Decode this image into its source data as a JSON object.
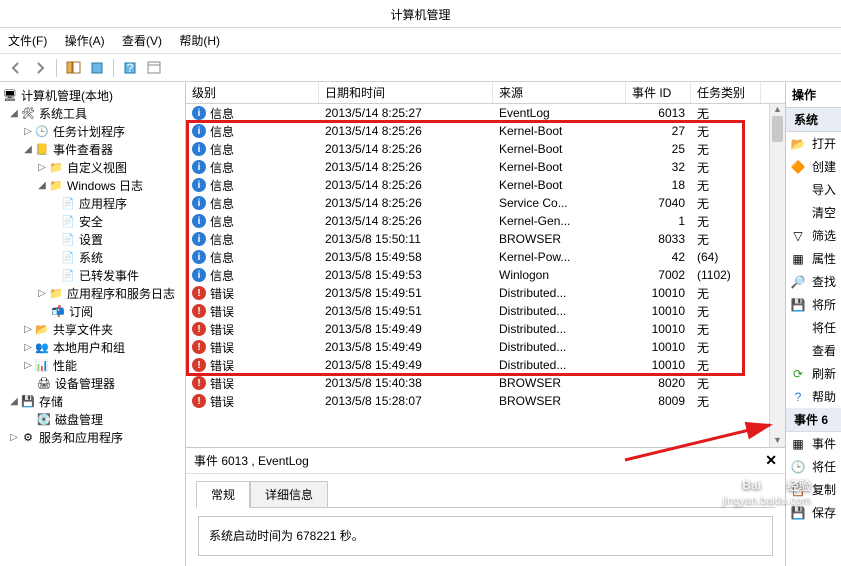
{
  "window": {
    "title": "计算机管理"
  },
  "menu": {
    "file": "文件(F)",
    "action": "操作(A)",
    "view": "查看(V)",
    "help": "帮助(H)"
  },
  "tree": {
    "root": "计算机管理(本地)",
    "systools": "系统工具",
    "scheduler": "任务计划程序",
    "eventviewer": "事件查看器",
    "customviews": "自定义视图",
    "winlogs": "Windows 日志",
    "app": "应用程序",
    "security": "安全",
    "setup": "设置",
    "system": "系统",
    "forwarded": "已转发事件",
    "appsvc": "应用程序和服务日志",
    "subs": "订阅",
    "shared": "共享文件夹",
    "users": "本地用户和组",
    "perf": "性能",
    "devmgr": "设备管理器",
    "storage": "存储",
    "diskmgr": "磁盘管理",
    "services": "服务和应用程序"
  },
  "cols": {
    "level": "级别",
    "datetime": "日期和时间",
    "source": "来源",
    "eventid": "事件 ID",
    "taskcat": "任务类别"
  },
  "rows": [
    {
      "lvl": "info",
      "level": "信息",
      "dt": "2013/5/14 8:25:27",
      "src": "EventLog",
      "id": "6013",
      "cat": "无"
    },
    {
      "lvl": "info",
      "level": "信息",
      "dt": "2013/5/14 8:25:26",
      "src": "Kernel-Boot",
      "id": "27",
      "cat": "无"
    },
    {
      "lvl": "info",
      "level": "信息",
      "dt": "2013/5/14 8:25:26",
      "src": "Kernel-Boot",
      "id": "25",
      "cat": "无"
    },
    {
      "lvl": "info",
      "level": "信息",
      "dt": "2013/5/14 8:25:26",
      "src": "Kernel-Boot",
      "id": "32",
      "cat": "无"
    },
    {
      "lvl": "info",
      "level": "信息",
      "dt": "2013/5/14 8:25:26",
      "src": "Kernel-Boot",
      "id": "18",
      "cat": "无"
    },
    {
      "lvl": "info",
      "level": "信息",
      "dt": "2013/5/14 8:25:26",
      "src": "Service Co...",
      "id": "7040",
      "cat": "无"
    },
    {
      "lvl": "info",
      "level": "信息",
      "dt": "2013/5/14 8:25:26",
      "src": "Kernel-Gen...",
      "id": "1",
      "cat": "无"
    },
    {
      "lvl": "info",
      "level": "信息",
      "dt": "2013/5/8 15:50:11",
      "src": "BROWSER",
      "id": "8033",
      "cat": "无"
    },
    {
      "lvl": "info",
      "level": "信息",
      "dt": "2013/5/8 15:49:58",
      "src": "Kernel-Pow...",
      "id": "42",
      "cat": "(64)"
    },
    {
      "lvl": "info",
      "level": "信息",
      "dt": "2013/5/8 15:49:53",
      "src": "Winlogon",
      "id": "7002",
      "cat": "(1102)"
    },
    {
      "lvl": "err",
      "level": "错误",
      "dt": "2013/5/8 15:49:51",
      "src": "Distributed...",
      "id": "10010",
      "cat": "无"
    },
    {
      "lvl": "err",
      "level": "错误",
      "dt": "2013/5/8 15:49:51",
      "src": "Distributed...",
      "id": "10010",
      "cat": "无"
    },
    {
      "lvl": "err",
      "level": "错误",
      "dt": "2013/5/8 15:49:49",
      "src": "Distributed...",
      "id": "10010",
      "cat": "无"
    },
    {
      "lvl": "err",
      "level": "错误",
      "dt": "2013/5/8 15:49:49",
      "src": "Distributed...",
      "id": "10010",
      "cat": "无"
    },
    {
      "lvl": "err",
      "level": "错误",
      "dt": "2013/5/8 15:49:49",
      "src": "Distributed...",
      "id": "10010",
      "cat": "无"
    },
    {
      "lvl": "err",
      "level": "错误",
      "dt": "2013/5/8 15:40:38",
      "src": "BROWSER",
      "id": "8020",
      "cat": "无"
    },
    {
      "lvl": "err",
      "level": "错误",
      "dt": "2013/5/8 15:28:07",
      "src": "BROWSER",
      "id": "8009",
      "cat": "无"
    }
  ],
  "detail": {
    "header": "事件 6013 , EventLog",
    "tab_general": "常规",
    "tab_detail": "详细信息",
    "desc": "系统启动时间为 678221 秒。"
  },
  "actions": {
    "header": "操作",
    "group1": "系统",
    "open": "打开",
    "create": "创建",
    "import": "导入",
    "clear": "清空",
    "filter": "筛选",
    "props": "属性",
    "find": "查找",
    "saveAs": "将所",
    "attach": "将任",
    "view": "查看",
    "refresh": "刷新",
    "help": "帮助",
    "group2": "事件 6",
    "evprops": "事件",
    "attach2": "将任",
    "copy": "复制",
    "save": "保存"
  },
  "watermark": {
    "brand1": "Bai",
    "brand2": "经验",
    "url": "jingyan.baidu.com"
  }
}
